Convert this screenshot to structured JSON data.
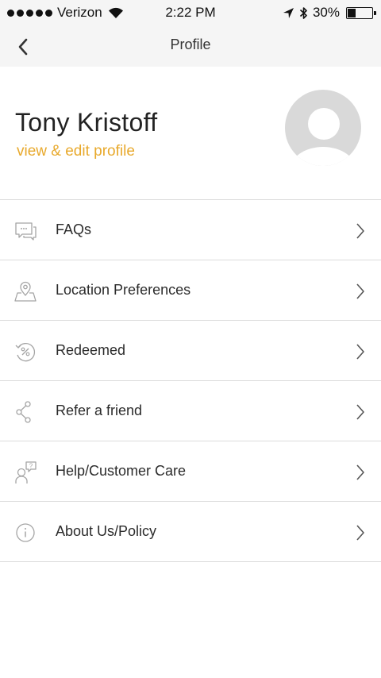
{
  "status_bar": {
    "carrier": "Verizon",
    "time": "2:22 PM",
    "battery": "30%",
    "battery_level": 0.3,
    "icons": [
      "signal-dots-icon",
      "wifi-icon",
      "location-arrow-icon",
      "bluetooth-icon",
      "battery-icon"
    ]
  },
  "nav": {
    "title": "Profile",
    "back_icon": "chevron-left-icon"
  },
  "profile": {
    "name": "Tony Kristoff",
    "edit_link": "view & edit profile",
    "avatar_icon": "default-avatar-icon"
  },
  "menu": {
    "items": [
      {
        "label": "FAQs",
        "icon": "chat-bubbles-icon"
      },
      {
        "label": "Location Preferences",
        "icon": "map-pin-icon"
      },
      {
        "label": "Redeemed",
        "icon": "percent-refresh-icon"
      },
      {
        "label": "Refer a friend",
        "icon": "share-icon"
      },
      {
        "label": "Help/Customer Care",
        "icon": "customer-care-icon"
      },
      {
        "label": "About Us/Policy",
        "icon": "info-icon"
      }
    ]
  },
  "colors": {
    "accent": "#e8a92c",
    "header_bg": "#f5f5f5",
    "divider": "#dcdcdc",
    "icon_gray": "#a5a5a5",
    "avatar_bg": "#d9d9d9"
  }
}
